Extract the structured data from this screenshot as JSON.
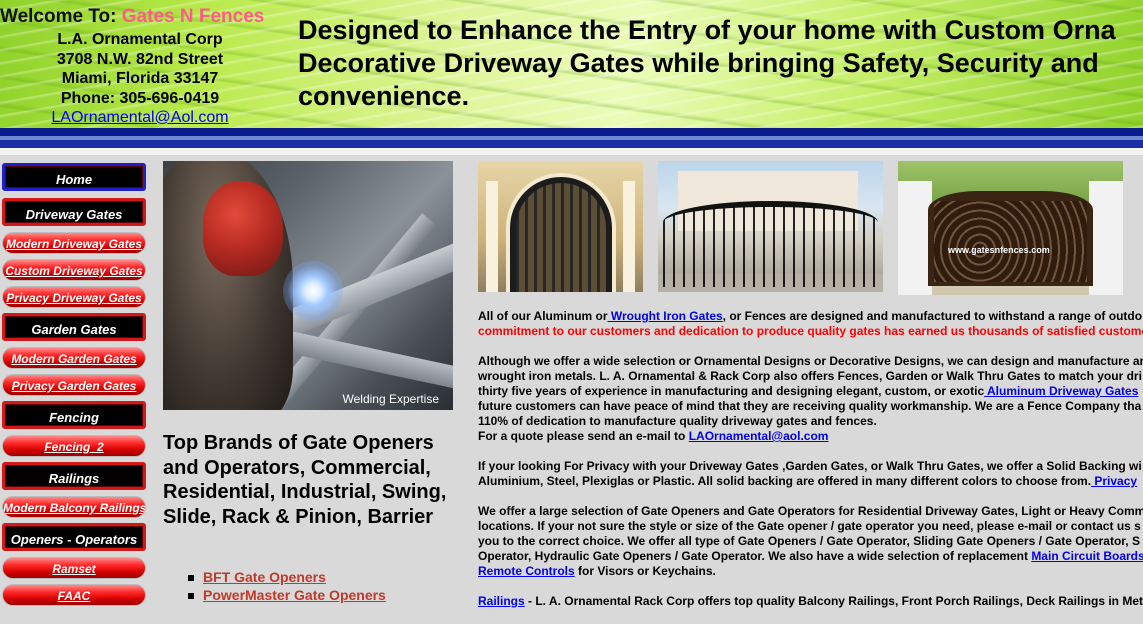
{
  "header": {
    "welcome_prefix": "Welcome To: ",
    "company": "Gates N Fences",
    "address_lines": [
      "L.A. Ornamental Corp",
      "3708 N.W. 82nd Street",
      "Miami, Florida 33147",
      "Phone: 305-696-0419"
    ],
    "email": "LAOrnamental@Aol.com",
    "headline_lines": [
      "Designed to Enhance the Entry of your home with Custom Orna",
      "Decorative Driveway Gates while bringing Safety, Security and",
      "convenience."
    ]
  },
  "sidebar": {
    "items": [
      {
        "label": "Home",
        "style": "black-blue"
      },
      {
        "label": "Driveway Gates",
        "style": "black"
      },
      {
        "label": "Modern Driveway Gates",
        "style": "red"
      },
      {
        "label": "Custom Driveway Gates",
        "style": "red"
      },
      {
        "label": "Privacy Driveway Gates",
        "style": "red"
      },
      {
        "label": "Garden Gates",
        "style": "black"
      },
      {
        "label": "Modern Garden Gates",
        "style": "red"
      },
      {
        "label": "Privacy Garden Gates",
        "style": "red"
      },
      {
        "label": "Fencing",
        "style": "black"
      },
      {
        "label": "Fencing_2",
        "style": "red"
      },
      {
        "label": "Railings",
        "style": "black"
      },
      {
        "label": "Modern Balcony Railings",
        "style": "red"
      },
      {
        "label": "Openers - Operators",
        "style": "black"
      },
      {
        "label": "Ramset",
        "style": "red"
      },
      {
        "label": "FAAC",
        "style": "red"
      }
    ]
  },
  "welding_photo": {
    "caption": "Welding Expertise"
  },
  "photos": {
    "photo3_watermark": "www.gatesnfences.com"
  },
  "brands": {
    "title": "Top Brands of Gate Openers and Operators, Commercial, Residential, Industrial, Swing, Slide, Rack & Pinion, Barrier",
    "items": [
      "BFT Gate Openers",
      "PowerMaster Gate Openers"
    ]
  },
  "content": {
    "p1": {
      "t1": "All of our Aluminum or",
      "link1": " Wrought Iron Gates",
      "t2": ", or Fences are designed and manufactured to withstand a range of outdo",
      "red": "commitment to our customers and dedication to produce quality gates has earned us thousands of satisfied custome"
    },
    "p2": {
      "l1": "Although we offer a wide selection or Ornamental Designs or Decorative Designs, we can design and manufacture an",
      "l2": "wrought iron metals. L. A. Ornamental & Rack Corp also offers Fences, Garden or Walk Thru Gates to match your dri",
      "l3a": "thirty five years of experience in manufacturing and designing elegant, custom, or exotic",
      "l3link": " Aluminum Driveway Gates",
      "l4": "future customers can have peace of mind that they are receiving quality workmanship.  We are a Fence Company tha",
      "l5": "110% of dedication to manufacture quality driveway gates and fences.",
      "l6a": "For a quote please send an e-mail to ",
      "l6link": "LAOrnamental@aol.com"
    },
    "p3": {
      "l1": "If your looking For Privacy with your Driveway Gates ,Garden Gates, or Walk Thru Gates, we offer a Solid Backing wi",
      "l2a": "Aluminium, Steel, Plexiglas or Plastic.  All solid backing are offered in many different colors to choose from.",
      "l2link": " Privacy"
    },
    "p4": {
      "l1": "We offer a large selection of  Gate Openers and Gate Operators for Residential Driveway Gates, Light or Heavy Comm",
      "l2": "locations. If your not sure the style or size of the Gate opener / gate operator  you need, please e-mail or contact us s",
      "l3": "you to the correct choice. We offer all type of Gate Openers / Gate Operator, Sliding Gate Openers / Gate Operator, S",
      "l4a": "Operator, Hydraulic Gate Openers / Gate Operator. We also have a wide selection of replacement ",
      "l4link": "Main Circuit Boards",
      "l5link": "Remote Controls",
      "l5b": "  for Visors or Keychains."
    },
    "p5": {
      "link": "Railings",
      "text": " - L. A. Ornamental Rack Corp offers top quality Balcony Railings, Front Porch Railings, Deck Railings in Met"
    }
  },
  "colors": {
    "company": "#ff5b8a",
    "link": "#0000ee",
    "emphasis": "#ff0000",
    "brand_link": "#c0392b",
    "header_band": "#0a1a8a"
  }
}
